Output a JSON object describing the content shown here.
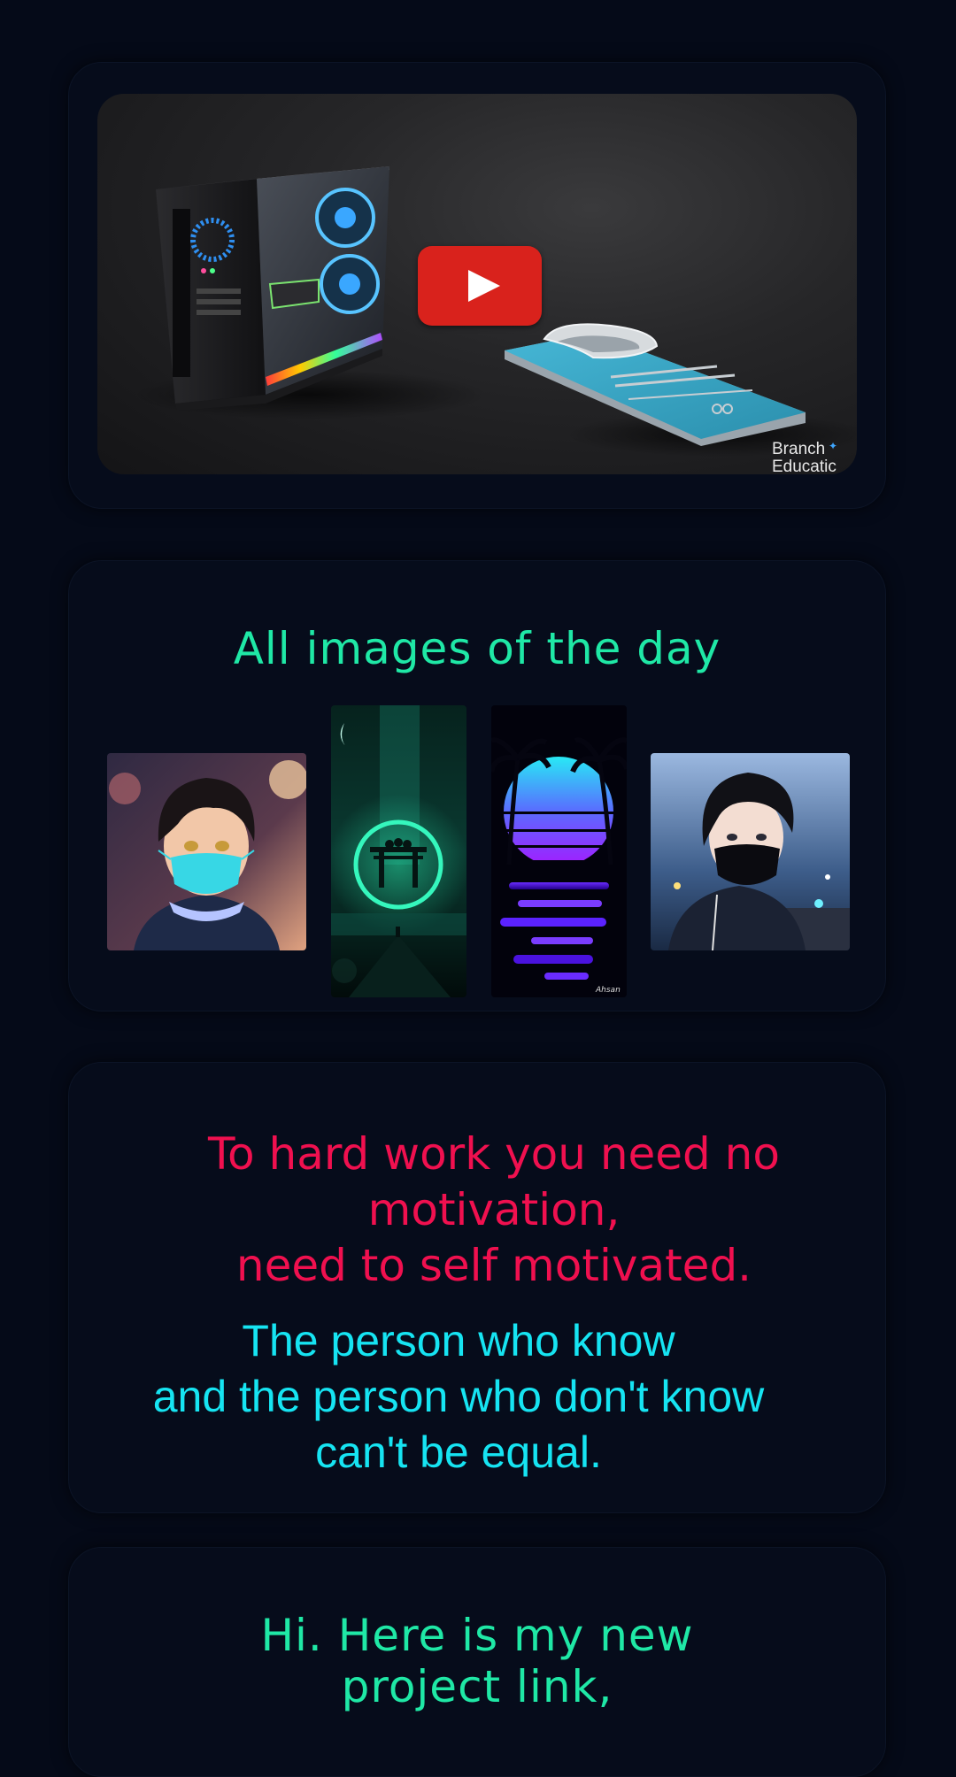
{
  "video": {
    "watermark_line1": "Branch",
    "watermark_line2": "Educatic",
    "play_icon": "youtube-play-icon",
    "accent_color": "#d9221c"
  },
  "gallery": {
    "title": "All images of the day",
    "title_color": "#1fe8a6",
    "images": [
      {
        "subject": "anime boy with blue face mask"
      },
      {
        "subject": "neon torii gate with glowing circle"
      },
      {
        "subject": "synthwave palm tree sunset"
      },
      {
        "subject": "anime boy with black mask in night city"
      }
    ],
    "signature": "Ahsan"
  },
  "quote": {
    "red_text": "To hard work you need no\nmotivation,\nneed to self motivated.",
    "cyan_text": "The person who know\nand the person who don't know\ncan't be equal.",
    "red_color": "#f0104f",
    "cyan_color": "#16e4f2"
  },
  "project": {
    "text": "Hi. Here is my new\nproject link,"
  }
}
